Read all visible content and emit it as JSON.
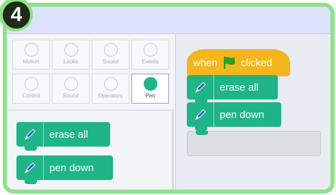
{
  "step_number": "4",
  "categories": [
    {
      "label": "Motion"
    },
    {
      "label": "Looks"
    },
    {
      "label": "Sound"
    },
    {
      "label": "Events"
    },
    {
      "label": "Control"
    },
    {
      "label": "Sound"
    },
    {
      "label": "Operators"
    },
    {
      "label": "Pen",
      "selected": true
    }
  ],
  "palette_blocks": [
    {
      "label": "erase all"
    },
    {
      "label": "pen down"
    }
  ],
  "script": {
    "hat_when": "when",
    "hat_clicked": "clicked",
    "blocks": [
      {
        "label": "erase all"
      },
      {
        "label": "pen down"
      }
    ]
  },
  "colors": {
    "frame": "#8fe28a",
    "pen_block": "#1fb587",
    "event_block": "#f5b51d",
    "flag": "#2d9e22"
  }
}
